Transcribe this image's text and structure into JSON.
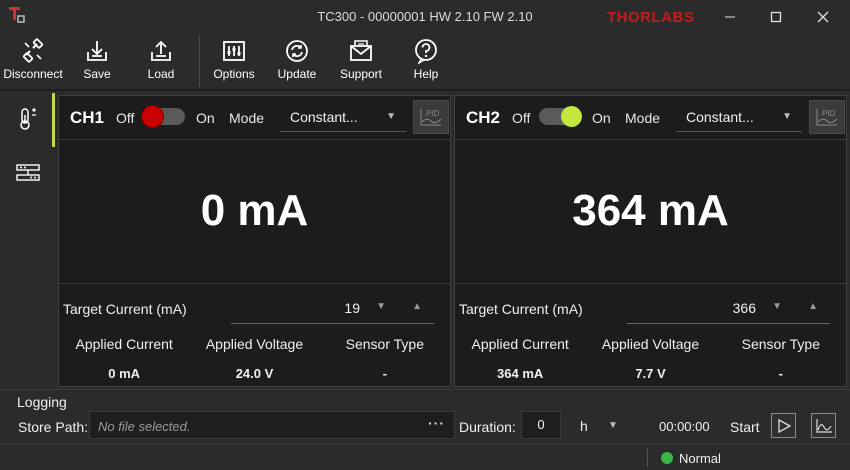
{
  "window": {
    "title": "TC300 - 00000001 HW 2.10 FW 2.10",
    "brand": "THORLABS",
    "icons": {
      "app": "tc300-logo-icon",
      "minimize": "minimize-icon",
      "maximize": "maximize-icon",
      "close": "close-icon"
    }
  },
  "toolbar": {
    "disconnect": "Disconnect",
    "save": "Save",
    "load": "Load",
    "options": "Options",
    "update": "Update",
    "support": "Support",
    "help": "Help"
  },
  "nav": {
    "items": [
      "temperature-icon",
      "channels-icon"
    ],
    "active_index": 0
  },
  "channels": [
    {
      "name": "CH1",
      "off_label": "Off",
      "on_label": "On",
      "enabled": false,
      "mode_label": "Mode",
      "mode_value": "Constant...",
      "pid_label": "PID",
      "display_value": "0 mA",
      "target_label": "Target Current (mA)",
      "target_value": "19",
      "info_headers": [
        "Applied Current",
        "Applied Voltage",
        "Sensor Type"
      ],
      "info_values": [
        "0 mA",
        "24.0 V",
        "-"
      ]
    },
    {
      "name": "CH2",
      "off_label": "Off",
      "on_label": "On",
      "enabled": true,
      "mode_label": "Mode",
      "mode_value": "Constant...",
      "pid_label": "PID",
      "display_value": "364 mA",
      "target_label": "Target Current (mA)",
      "target_value": "366",
      "info_headers": [
        "Applied Current",
        "Applied Voltage",
        "Sensor Type"
      ],
      "info_values": [
        "364 mA",
        "7.7 V",
        "-"
      ]
    }
  ],
  "logging": {
    "title": "Logging",
    "store_path_label": "Store Path:",
    "store_path_placeholder": "No file selected.",
    "browse_label": "···",
    "duration_label": "Duration:",
    "duration_value": "0",
    "unit_value": "h",
    "timer": "00:00:00",
    "start_label": "Start"
  },
  "status": {
    "text": "Normal",
    "color": "#39b54a"
  },
  "colors": {
    "accent": "#c5d94a",
    "off_knob": "#c80000",
    "on_knob": "#c5e63a",
    "brand": "#c81a1a"
  }
}
